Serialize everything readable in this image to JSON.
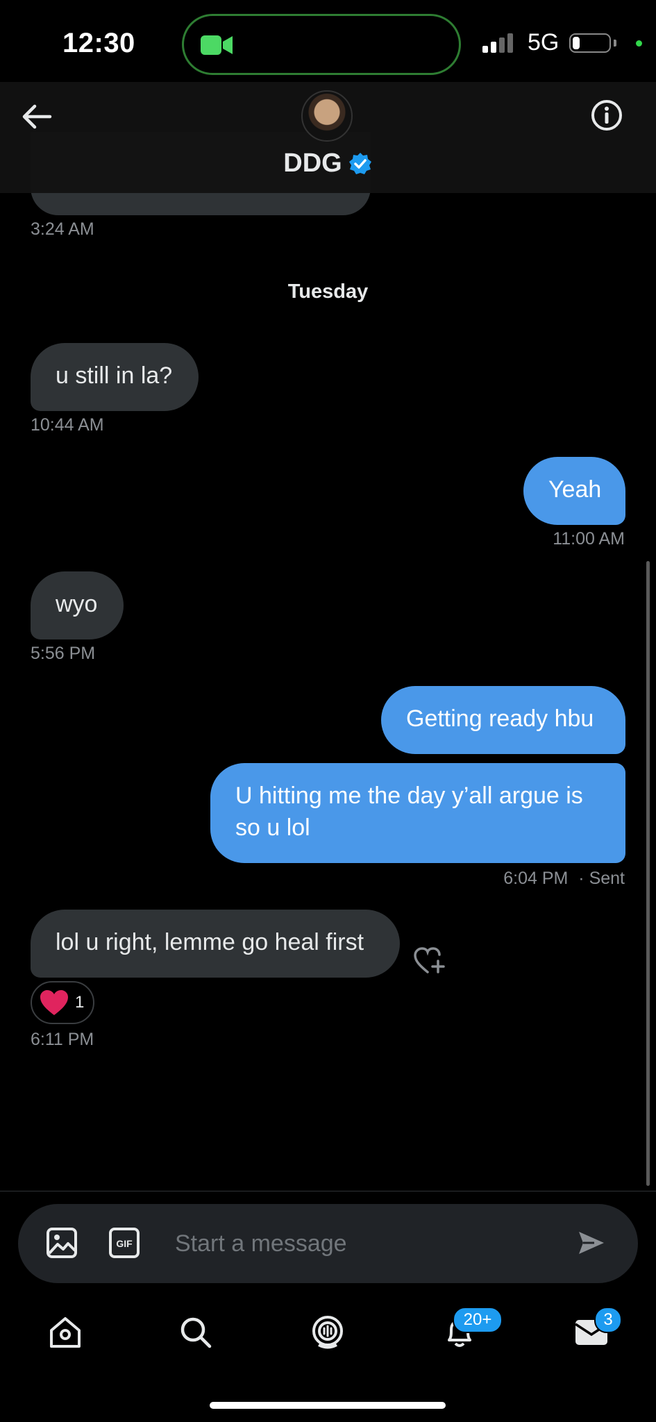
{
  "status_bar": {
    "time": "12:30",
    "network": "5G",
    "battery_level": 0.2,
    "icons": [
      "video-camera-icon",
      "signal-icon",
      "battery-icon",
      "privacy-dot-icon"
    ]
  },
  "header": {
    "contact_name": "DDG",
    "verified": true,
    "icons": [
      "back-arrow-icon",
      "avatar",
      "verified-badge-icon",
      "info-icon"
    ]
  },
  "conversation": {
    "previous_timestamp": "3:24 AM",
    "day_separator": "Tuesday",
    "messages": [
      {
        "side": "incoming",
        "text": "u still in la?",
        "timestamp": "10:44 AM"
      },
      {
        "side": "outgoing",
        "text": "Yeah",
        "timestamp": "11:00 AM"
      },
      {
        "side": "incoming",
        "text": "wyo",
        "timestamp": "5:56 PM"
      },
      {
        "side": "outgoing",
        "text": "Getting ready hbu",
        "timestamp": ""
      },
      {
        "side": "outgoing",
        "text": "U hitting me the day y’all argue is so u lol",
        "timestamp": "6:04 PM",
        "status": "· Sent"
      },
      {
        "side": "incoming",
        "text": "lol u right, lemme go heal first",
        "timestamp": "6:11 PM",
        "reaction": {
          "emoji": "heart",
          "count": "1"
        }
      }
    ]
  },
  "composer": {
    "placeholder": "Start a message",
    "icons": [
      "image-icon",
      "gif-icon",
      "send-icon"
    ]
  },
  "tab_bar": {
    "tabs": [
      {
        "name": "home",
        "icon": "home-icon"
      },
      {
        "name": "search",
        "icon": "search-icon"
      },
      {
        "name": "spaces",
        "icon": "spaces-icon"
      },
      {
        "name": "notifications",
        "icon": "bell-icon",
        "badge": "20+"
      },
      {
        "name": "messages",
        "icon": "envelope-icon",
        "badge": "3"
      }
    ]
  },
  "colors": {
    "background": "#000000",
    "incoming_bubble": "#2f3336",
    "outgoing_bubble": "#4a98e9",
    "accent": "#1d9bf0",
    "timestamp": "#8b8f94",
    "reaction_heart": "#f91880"
  }
}
